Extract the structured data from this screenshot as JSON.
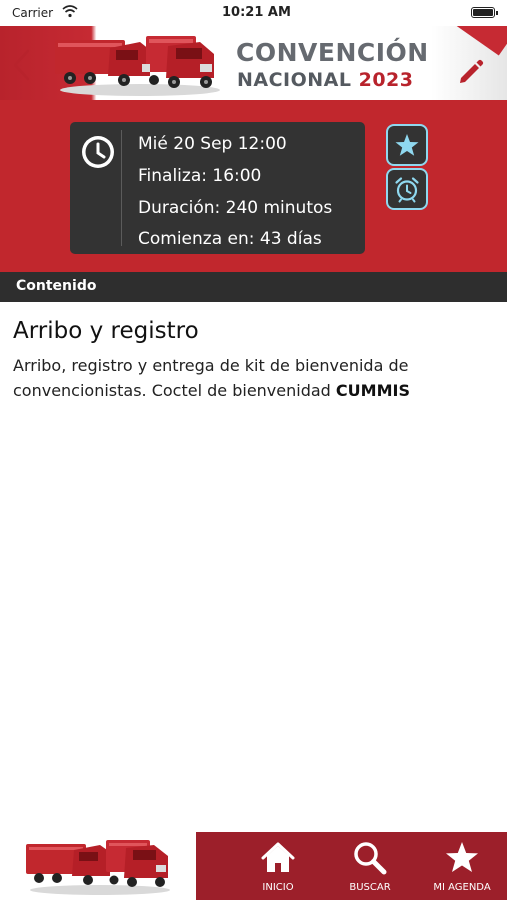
{
  "status_bar": {
    "carrier": "Carrier",
    "time": "10:21 AM"
  },
  "header": {
    "title_line1": "CONVENCIÓN",
    "title_line2_word": "NACIONAL",
    "title_line2_year": "2023",
    "back_icon": "chevron-left-icon",
    "edit_icon": "pencil-icon",
    "brand_color": "#c1272d"
  },
  "event_info": {
    "date_time": "Mié 20  Sep  12:00",
    "ends": "Finaliza: 16:00",
    "duration": "Duración: 240 minutos",
    "starts_in": "Comienza en: 43 días",
    "clock_icon": "clock-icon",
    "favorite_icon": "star-icon",
    "alarm_icon": "alarm-clock-icon",
    "accent_color": "#8fd8ef"
  },
  "section": {
    "label": "Contenido"
  },
  "content": {
    "title": "Arribo y registro",
    "body_text": "Arribo, registro y entrega de kit de bienvenida de convencionistas. Coctel de bienvenidad ",
    "body_bold": "CUMMIS"
  },
  "bottom_nav": {
    "items": [
      {
        "label": "INICIO",
        "icon": "home-icon"
      },
      {
        "label": "BUSCAR",
        "icon": "search-icon"
      },
      {
        "label": "MI AGENDA",
        "icon": "star-icon"
      }
    ],
    "background_color": "#9c1f2a"
  }
}
